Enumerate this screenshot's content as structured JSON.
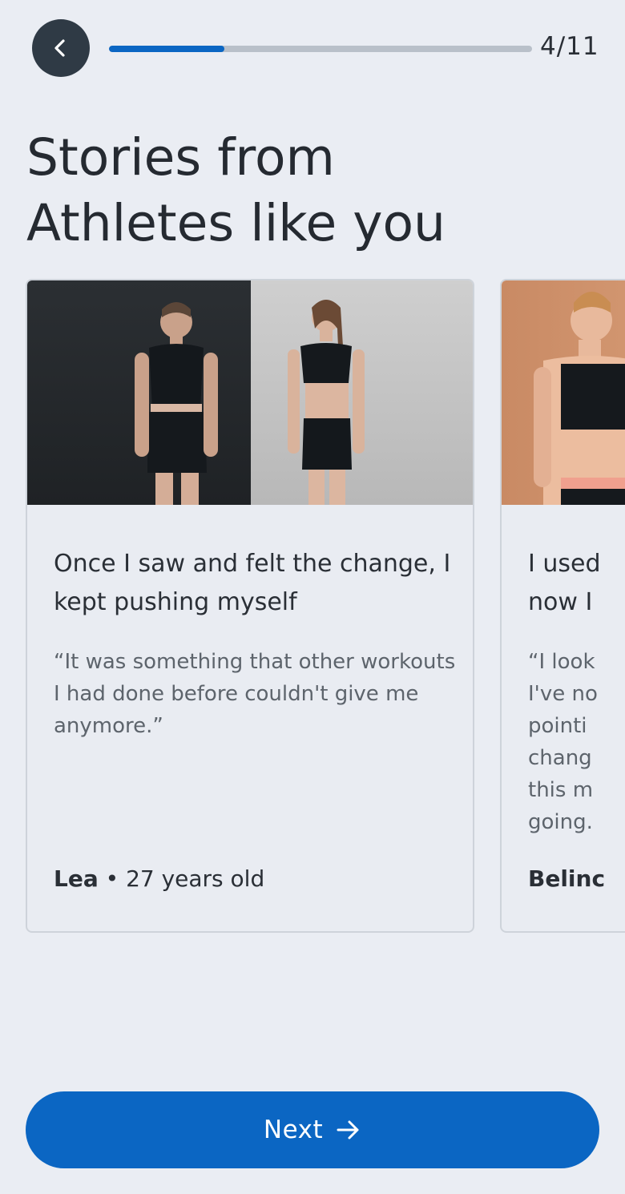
{
  "header": {
    "back_icon": "chevron-left-icon",
    "progress": {
      "current": 4,
      "total": 11,
      "fraction": 0.2727,
      "label": "4/11"
    },
    "colors": {
      "track": "#b9c0c9",
      "fill": "#0b66c3",
      "back_button": "#2f3a45"
    }
  },
  "title": {
    "line1": "Stories from",
    "line2": "Athletes like you"
  },
  "stories": [
    {
      "headline": "Once I saw and felt the change, I kept pushing myself",
      "quote": "“It was something that other workouts I had done before couldn't give me anymore.”",
      "name": "Lea",
      "separator": " • ",
      "age": "27 years old"
    },
    {
      "headline": "I used",
      "headline_line2": "now I",
      "quote_lines": [
        "“I look",
        "I've no",
        "pointi",
        "chang",
        "this m",
        "going."
      ],
      "name": "Belinc"
    }
  ],
  "footer": {
    "next_label": "Next",
    "next_icon": "arrow-right-icon",
    "accent": "#0b66c3"
  }
}
